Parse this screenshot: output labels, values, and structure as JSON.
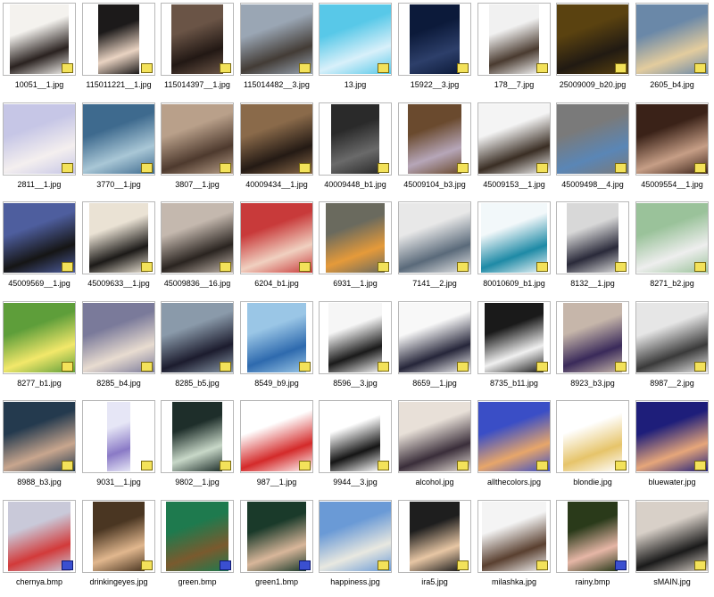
{
  "colors": {
    "thumbnail_border": "#b8b8b8",
    "caption_text": "#000000",
    "background": "#ffffff"
  },
  "files": [
    {
      "name": "10051__1.jpg",
      "type": "jpg",
      "c": [
        "#f4f2ee",
        "#2a2220"
      ],
      "w": 66
    },
    {
      "name": "115011221__1.jpg",
      "type": "jpg",
      "c": [
        "#1c1a1a",
        "#e9d3c2"
      ],
      "w": 46
    },
    {
      "name": "115014397__1.jpg",
      "type": "jpg",
      "c": [
        "#6a5446",
        "#221814"
      ],
      "w": 58
    },
    {
      "name": "115014482__3.jpg",
      "type": "jpg",
      "c": [
        "#9aa6b4",
        "#433c36"
      ],
      "w": 80
    },
    {
      "name": "13.jpg",
      "type": "jpg",
      "c": [
        "#58c8e8",
        "#d8f0fa"
      ],
      "w": 80
    },
    {
      "name": "15922__3.jpg",
      "type": "jpg",
      "c": [
        "#0c1a3a",
        "#2d3f6a"
      ],
      "w": 56
    },
    {
      "name": "178__7.jpg",
      "type": "jpg",
      "c": [
        "#f1f1f1",
        "#4a3b30"
      ],
      "w": 56
    },
    {
      "name": "25009009_b20.jpg",
      "type": "jpg",
      "c": [
        "#5a4210",
        "#211a12"
      ],
      "w": 80
    },
    {
      "name": "2605_b4.jpg",
      "type": "jpg",
      "c": [
        "#6a88a8",
        "#e3cc9e"
      ],
      "w": 80
    },
    {
      "name": "2811__1.jpg",
      "type": "jpg",
      "c": [
        "#c6c6e6",
        "#f4efef"
      ],
      "w": 80
    },
    {
      "name": "3770__1.jpg",
      "type": "jpg",
      "c": [
        "#3e6a8e",
        "#a9c7d6"
      ],
      "w": 80
    },
    {
      "name": "3807__1.jpg",
      "type": "jpg",
      "c": [
        "#b9a08a",
        "#4e3a2e"
      ],
      "w": 80
    },
    {
      "name": "40009434__1.jpg",
      "type": "jpg",
      "c": [
        "#8a6a4a",
        "#241a14"
      ],
      "w": 80
    },
    {
      "name": "40009448_b1.jpg",
      "type": "jpg",
      "c": [
        "#2a2a2a",
        "#6a6a6a"
      ],
      "w": 54
    },
    {
      "name": "45009104_b3.jpg",
      "type": "jpg",
      "c": [
        "#6a4a2e",
        "#b6a6b8"
      ],
      "w": 60
    },
    {
      "name": "45009153__1.jpg",
      "type": "jpg",
      "c": [
        "#f4f4f4",
        "#3a2e24"
      ],
      "w": 80
    },
    {
      "name": "45009498__4.jpg",
      "type": "jpg",
      "c": [
        "#7a7a7a",
        "#5a86b6"
      ],
      "w": 80
    },
    {
      "name": "45009554__1.jpg",
      "type": "jpg",
      "c": [
        "#3a2218",
        "#c69e86"
      ],
      "w": 80
    },
    {
      "name": "45009569__1.jpg",
      "type": "jpg",
      "c": [
        "#4e5e9e",
        "#151515"
      ],
      "w": 80
    },
    {
      "name": "45009633__1.jpg",
      "type": "jpg",
      "c": [
        "#eae2d4",
        "#1c1a18"
      ],
      "w": 66
    },
    {
      "name": "45009836__16.jpg",
      "type": "jpg",
      "c": [
        "#c4b8ae",
        "#2a2420"
      ],
      "w": 80
    },
    {
      "name": "6204_b1.jpg",
      "type": "jpg",
      "c": [
        "#c83a3a",
        "#f0d0c0"
      ],
      "w": 80
    },
    {
      "name": "6931__1.jpg",
      "type": "jpg",
      "c": [
        "#6a6a5e",
        "#e59a3a"
      ],
      "w": 66
    },
    {
      "name": "7141__2.jpg",
      "type": "jpg",
      "c": [
        "#e8e8e8",
        "#5a6a7a"
      ],
      "w": 80
    },
    {
      "name": "80010609_b1.jpg",
      "type": "jpg",
      "c": [
        "#f2f8fa",
        "#1e8aa6"
      ],
      "w": 74
    },
    {
      "name": "8132__1.jpg",
      "type": "jpg",
      "c": [
        "#d8d8d8",
        "#2a2a3a"
      ],
      "w": 58
    },
    {
      "name": "8271_b2.jpg",
      "type": "jpg",
      "c": [
        "#9ac29a",
        "#eeeeee"
      ],
      "w": 80
    },
    {
      "name": "8277_b1.jpg",
      "type": "jpg",
      "c": [
        "#5e9e3a",
        "#f2e86a"
      ],
      "w": 80
    },
    {
      "name": "8285_b4.jpg",
      "type": "jpg",
      "c": [
        "#7a7a9a",
        "#e8dcd0"
      ],
      "w": 80
    },
    {
      "name": "8285_b5.jpg",
      "type": "jpg",
      "c": [
        "#8a9aaa",
        "#1c1c2e"
      ],
      "w": 80
    },
    {
      "name": "8549_b9.jpg",
      "type": "jpg",
      "c": [
        "#9ac6e6",
        "#2e6aae"
      ],
      "w": 66
    },
    {
      "name": "8596__3.jpg",
      "type": "jpg",
      "c": [
        "#f6f6f6",
        "#1a1a1a"
      ],
      "w": 60
    },
    {
      "name": "8659__1.jpg",
      "type": "jpg",
      "c": [
        "#f8f8f8",
        "#26263a"
      ],
      "w": 80
    },
    {
      "name": "8735_b11.jpg",
      "type": "jpg",
      "c": [
        "#1a1a1a",
        "#f0f0f0"
      ],
      "w": 66
    },
    {
      "name": "8923_b3.jpg",
      "type": "jpg",
      "c": [
        "#c6b6aa",
        "#3a2a5a"
      ],
      "w": 66
    },
    {
      "name": "8987__2.jpg",
      "type": "jpg",
      "c": [
        "#e6e6e6",
        "#3a3a3a"
      ],
      "w": 80
    },
    {
      "name": "8988_b3.jpg",
      "type": "jpg",
      "c": [
        "#243a4e",
        "#c8a68e"
      ],
      "w": 80
    },
    {
      "name": "9031__1.jpg",
      "type": "jpg",
      "c": [
        "#e6e6f6",
        "#8a7ac6"
      ],
      "w": 26
    },
    {
      "name": "9802__1.jpg",
      "type": "jpg",
      "c": [
        "#1e2e2a",
        "#c8d8c8"
      ],
      "w": 56
    },
    {
      "name": "987__1.jpg",
      "type": "jpg",
      "c": [
        "#ffffff",
        "#d42a2a"
      ],
      "w": 80
    },
    {
      "name": "9944__3.jpg",
      "type": "jpg",
      "c": [
        "#ffffff",
        "#151515"
      ],
      "w": 56
    },
    {
      "name": "alcohol.jpg",
      "type": "jpg",
      "c": [
        "#e8e0d8",
        "#3a2e3a"
      ],
      "w": 80
    },
    {
      "name": "allthecolors.jpg",
      "type": "jpg",
      "c": [
        "#3a4ec6",
        "#e7a66a"
      ],
      "w": 80
    },
    {
      "name": "blondie.jpg",
      "type": "jpg",
      "c": [
        "#ffffff",
        "#e6c46a"
      ],
      "w": 66
    },
    {
      "name": "bluewater.jpg",
      "type": "jpg",
      "c": [
        "#1e1e7a",
        "#e6a67a"
      ],
      "w": 80
    },
    {
      "name": "chernya.bmp",
      "type": "bmp",
      "c": [
        "#c9c9d9",
        "#d23a3a"
      ],
      "w": 70
    },
    {
      "name": "drinkingeyes.jpg",
      "type": "jpg",
      "c": [
        "#4a3622",
        "#e1b78e"
      ],
      "w": 58
    },
    {
      "name": "green.bmp",
      "type": "bmp",
      "c": [
        "#1e7a4e",
        "#7a5a2e"
      ],
      "w": 70
    },
    {
      "name": "green1.bmp",
      "type": "bmp",
      "c": [
        "#1a3a2a",
        "#d8b69a"
      ],
      "w": 66
    },
    {
      "name": "happiness.jpg",
      "type": "jpg",
      "c": [
        "#6a9ad6",
        "#e8e8e0"
      ],
      "w": 80
    },
    {
      "name": "ira5.jpg",
      "type": "jpg",
      "c": [
        "#1e1e1e",
        "#e7c6a4"
      ],
      "w": 56
    },
    {
      "name": "milashka.jpg",
      "type": "jpg",
      "c": [
        "#f4f4f4",
        "#5a4030"
      ],
      "w": 72
    },
    {
      "name": "rainy.bmp",
      "type": "bmp",
      "c": [
        "#2a3a1a",
        "#e6b6a6"
      ],
      "w": 56
    },
    {
      "name": "sMAIN.jpg",
      "type": "jpg",
      "c": [
        "#d8d0c8",
        "#1a1a1a"
      ],
      "w": 80
    }
  ]
}
